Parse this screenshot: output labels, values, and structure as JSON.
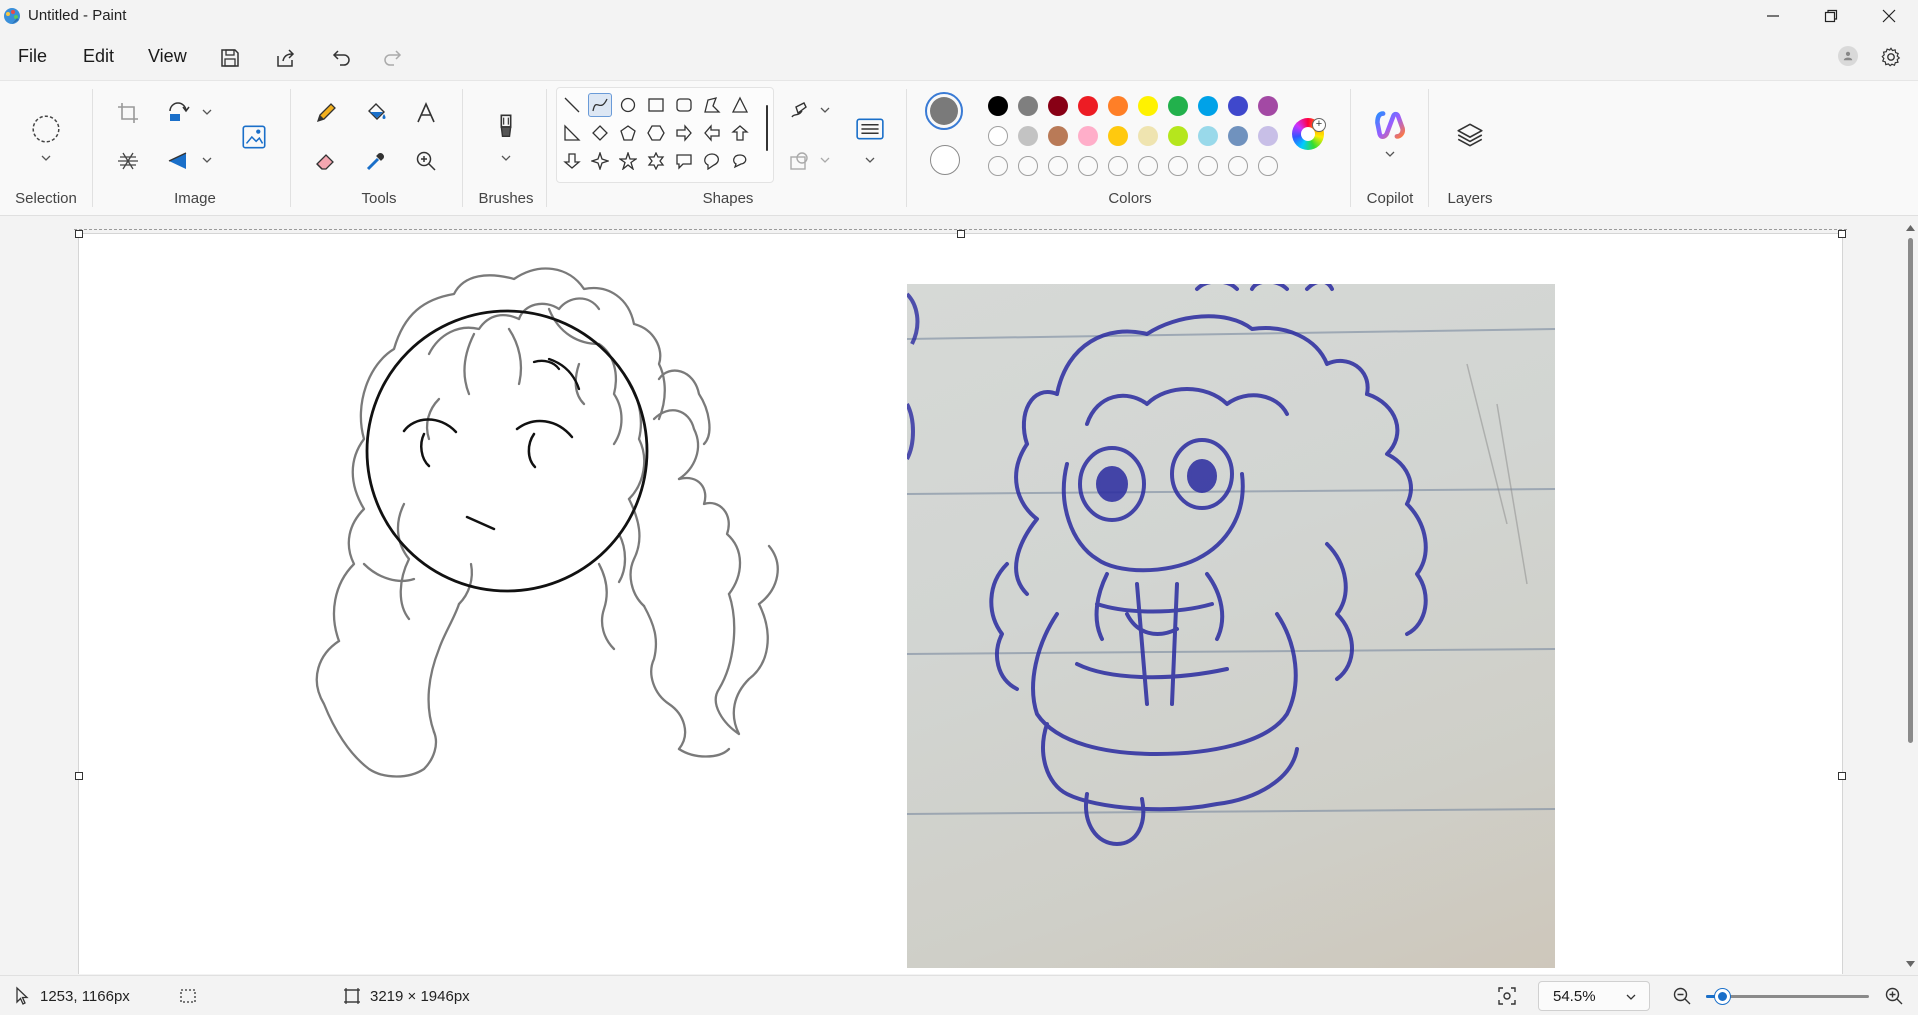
{
  "window": {
    "title": "Untitled - Paint"
  },
  "menu": {
    "file": "File",
    "edit": "Edit",
    "view": "View"
  },
  "ribbon": {
    "groups": {
      "selection": "Selection",
      "image": "Image",
      "tools": "Tools",
      "brushes": "Brushes",
      "shapes": "Shapes",
      "colors": "Colors",
      "copilot": "Copilot",
      "layers": "Layers"
    }
  },
  "colors": {
    "current": "#7a7a7a",
    "secondary": "#ffffff",
    "row1": [
      "#000000",
      "#7f7f7f",
      "#880015",
      "#ed1c24",
      "#ff7f27",
      "#fff200",
      "#22b14c",
      "#00a2e8",
      "#3f48cc",
      "#a349a4"
    ],
    "row2": [
      "#ffffff",
      "#c3c3c3",
      "#b97a57",
      "#ffaec9",
      "#ffc90e",
      "#efe4b0",
      "#b5e61d",
      "#99d9ea",
      "#7092be",
      "#c8bfe7"
    ],
    "row3_empty_count": 10,
    "accent": "#1a6fc9"
  },
  "status": {
    "cursor_position": "1253, 1166px",
    "canvas_size": "3219 × 1946px",
    "zoom": "54.5%",
    "zoom_fraction": 0.1
  }
}
